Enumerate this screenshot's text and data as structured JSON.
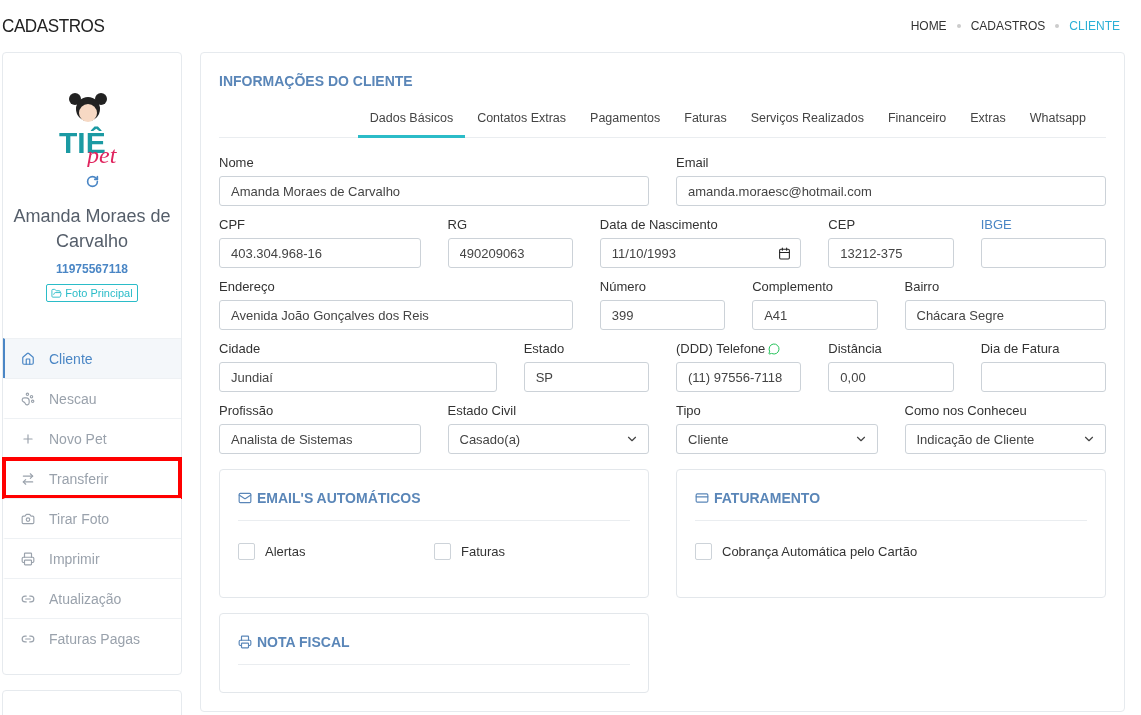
{
  "page_title": "CADASTROS",
  "breadcrumb": [
    {
      "label": "HOME",
      "selected": false
    },
    {
      "label": "CADASTROS",
      "selected": false
    },
    {
      "label": "CLIENTE",
      "selected": true
    }
  ],
  "profile": {
    "logo_word": "TIÊ",
    "logo_script": "pet",
    "name": "Amanda Moraes de Carvalho",
    "phone": "11975567118",
    "photo_button": "Foto Principal"
  },
  "menu": [
    {
      "label": "Cliente",
      "selected": true,
      "outlined": false
    },
    {
      "label": "Nescau",
      "selected": false,
      "outlined": false
    },
    {
      "label": "Novo Pet",
      "selected": false,
      "outlined": false
    },
    {
      "label": "Transferir",
      "selected": false,
      "outlined": true
    },
    {
      "label": "Tirar Foto",
      "selected": false,
      "outlined": false
    },
    {
      "label": "Imprimir",
      "selected": false,
      "outlined": false
    },
    {
      "label": "Atualização",
      "selected": false,
      "outlined": false
    },
    {
      "label": "Faturas Pagas",
      "selected": false,
      "outlined": false
    }
  ],
  "section_title": "INFORMAÇÕES DO CLIENTE",
  "tabs": [
    {
      "label": "Dados Básicos",
      "selected": true
    },
    {
      "label": "Contatos Extras",
      "selected": false
    },
    {
      "label": "Pagamentos",
      "selected": false
    },
    {
      "label": "Faturas",
      "selected": false
    },
    {
      "label": "Serviços Realizados",
      "selected": false
    },
    {
      "label": "Financeiro",
      "selected": false
    },
    {
      "label": "Extras",
      "selected": false
    },
    {
      "label": "Whatsapp",
      "selected": false
    }
  ],
  "form_rows": [
    [
      {
        "label": "Nome",
        "kind": "text",
        "value": "Amanda Moraes de Carvalho",
        "label_link": false
      },
      {
        "label": "Email",
        "kind": "text",
        "value": "amanda.moraesc@hotmail.com",
        "label_link": false
      }
    ],
    [
      {
        "label": "CPF",
        "kind": "text",
        "value": "403.304.968-16",
        "label_link": false
      },
      {
        "label": "RG",
        "kind": "text",
        "value": "490209063",
        "label_link": false
      },
      {
        "label": "Data de Nascimento",
        "kind": "date",
        "value": "11/10/1993",
        "label_link": false
      },
      {
        "label": "CEP",
        "kind": "text",
        "value": "13212-375",
        "label_link": false
      },
      {
        "label": "IBGE",
        "kind": "text",
        "label_link": true
      }
    ],
    [
      {
        "label": "Endereço",
        "kind": "text",
        "value": "Avenida João Gonçalves dos Reis",
        "label_link": false
      },
      {
        "label": "Número",
        "kind": "text",
        "value": "399",
        "label_link": false
      },
      {
        "label": "Complemento",
        "kind": "text",
        "value": "A41",
        "label_link": false
      },
      {
        "label": "Bairro",
        "kind": "text",
        "value": "Chácara Segre",
        "label_link": false
      }
    ],
    [
      {
        "label": "Cidade",
        "kind": "text",
        "value": "Jundiaí",
        "label_link": false
      },
      {
        "label": "Estado",
        "kind": "text",
        "value": "SP",
        "label_link": false
      },
      {
        "label": "(DDD) Telefone",
        "kind": "phone",
        "value": "(11) 97556-7118",
        "label_link": false
      },
      {
        "label": "Distância",
        "kind": "text",
        "value": "0,00",
        "label_link": false
      },
      {
        "label": "Dia de Fatura",
        "kind": "text",
        "label_link": false
      }
    ],
    [
      {
        "label": "Profissão",
        "kind": "text",
        "value": "Analista de Sistemas",
        "label_link": false
      },
      {
        "label": "Estado Civil",
        "kind": "select",
        "value": "Casado(a)",
        "label_link": false
      },
      {
        "label": "Tipo",
        "kind": "select",
        "value": "Cliente",
        "label_link": false
      },
      {
        "label": "Como nos Conheceu",
        "kind": "select",
        "value": "Indicação de Cliente",
        "label_link": false
      }
    ]
  ],
  "cards": [
    {
      "title": "EMAIL'S AUTOMÁTICOS",
      "options": [
        {
          "label": "Alertas",
          "checked": false
        },
        {
          "label": "Faturas",
          "checked": false
        }
      ]
    },
    {
      "title": "FATURAMENTO",
      "options": [
        {
          "label": "Cobrança Automática pelo Cartão",
          "checked": false
        }
      ]
    },
    {
      "title": "NOTA FISCAL"
    }
  ]
}
